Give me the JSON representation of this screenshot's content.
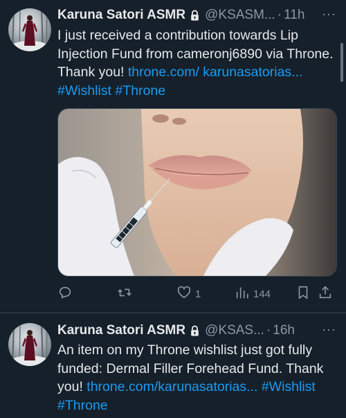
{
  "tweets": [
    {
      "author": {
        "name": "Karuna Satori ASMR",
        "handle": "@KSASM...",
        "protected": true
      },
      "time": "11h",
      "text_parts": {
        "plain": "I just received a contribution towards Lip Injection Fund from cameronj6890 via Throne. Thank you! ",
        "link": "throne.com/ karunasatorias...",
        "space": " ",
        "hashtag1": "#Wishlist",
        "hashtag2": "#Throne"
      },
      "has_media": true,
      "media_description_icon": "lip-injection-photo",
      "actions": {
        "reply_count": "",
        "retweet_count": "",
        "like_count": "1",
        "view_count": "144"
      }
    },
    {
      "author": {
        "name": "Karuna Satori ASMR",
        "handle": "@KSAS...",
        "protected": true
      },
      "time": "16h",
      "text_parts": {
        "plain": "An item on my Throne wishlist just got fully funded: Dermal Filler Forehead Fund. Thank you! ",
        "link": "throne.com/karunasatorias...",
        "hashtag1": "#Wishlist",
        "hashtag2": "#Throne"
      },
      "has_media": false
    }
  ],
  "separator_dot": "·",
  "more_label": "···",
  "colors": {
    "background": "#15202b",
    "text": "#e7e9ea",
    "muted": "#8b98a5",
    "link": "#1d9bf0",
    "border": "#38444d"
  }
}
